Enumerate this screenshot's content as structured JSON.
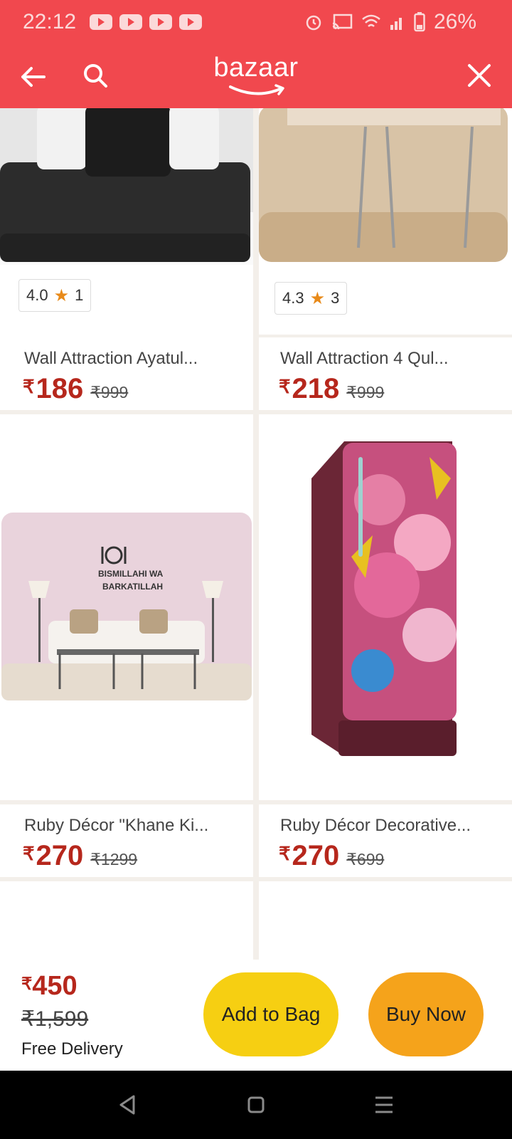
{
  "status": {
    "time": "22:12",
    "battery": "26%",
    "icons": [
      "youtube-icon",
      "youtube-icon",
      "youtube-icon",
      "youtube-icon",
      "alarm-icon",
      "cast-icon",
      "wifi-icon",
      "signal-icon",
      "battery-icon"
    ]
  },
  "header": {
    "logo": "bazaar",
    "icons": [
      "back-arrow-icon",
      "search-icon",
      "close-icon"
    ]
  },
  "products": [
    {
      "title": "Wall Attraction Ayatul...",
      "price": "186",
      "old_price": "₹999",
      "rating": "4.0",
      "reviews": "1"
    },
    {
      "title": "Wall Attraction 4 Qul...",
      "price": "218",
      "old_price": "₹999",
      "rating": "4.3",
      "reviews": "3"
    },
    {
      "title": "Ruby Décor \"Khane Ki...",
      "price": "270",
      "old_price": "₹1299",
      "wall_text_1": "BISMILLAHI WA",
      "wall_text_2": "BARKATILLAH"
    },
    {
      "title": "Ruby Décor Decorative...",
      "price": "270",
      "old_price": "₹699"
    }
  ],
  "currency_symbol": "₹",
  "bottom_bar": {
    "price": "450",
    "old_price": "₹1,599",
    "delivery": "Free Delivery",
    "add_to_bag": "Add to Bag",
    "buy_now": "Buy Now"
  },
  "colors": {
    "header": "#f1484e",
    "price": "#b6271c",
    "add_to_bag": "#f6cf12",
    "buy_now": "#f5a31b"
  },
  "nav": [
    "back-triangle-icon",
    "home-square-icon",
    "recents-menu-icon"
  ]
}
